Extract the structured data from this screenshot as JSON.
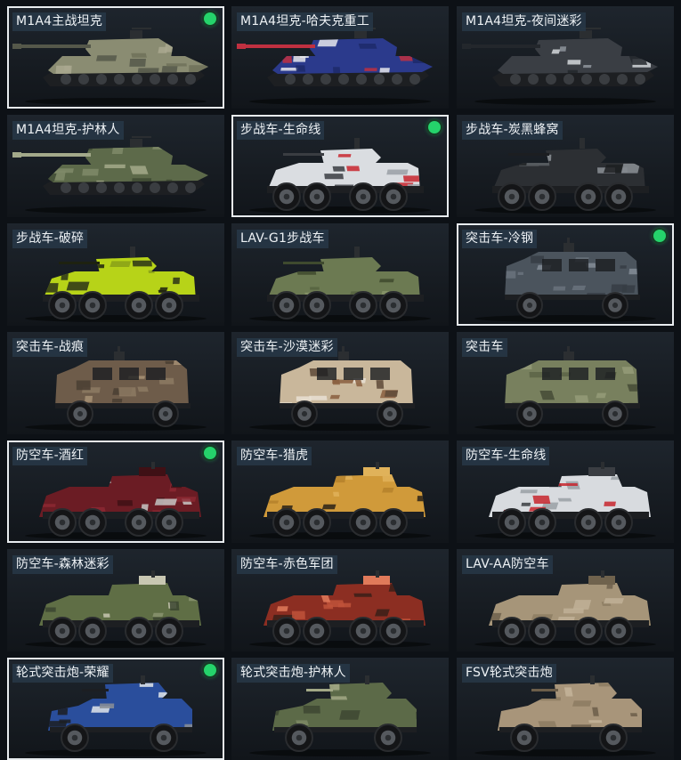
{
  "grid": {
    "columns": 3,
    "items": [
      {
        "label": "M1A4主战坦克",
        "kind": "tank",
        "camo": [
          "#8a8c72",
          "#6e7159",
          "#a9a88f",
          "#55584a"
        ],
        "selected": true,
        "equipped": true
      },
      {
        "label": "M1A4坦克-哈夫克重工",
        "kind": "tank",
        "camo": [
          "#2b3a8c",
          "#e6e8ec",
          "#1d2a6a",
          "#c03040"
        ],
        "selected": false,
        "equipped": false
      },
      {
        "label": "M1A4坦克-夜间迷彩",
        "kind": "tank",
        "camo": [
          "#3a3e44",
          "#8e949b",
          "#d5d8dc",
          "#23272c"
        ],
        "selected": false,
        "equipped": false
      },
      {
        "label": "M1A4坦克-护林人",
        "kind": "tank",
        "camo": [
          "#5d6a4a",
          "#7f8a68",
          "#3e4a33",
          "#a3a98a"
        ],
        "selected": false,
        "equipped": false
      },
      {
        "label": "步战车-生命线",
        "kind": "ifv",
        "camo": [
          "#dadde1",
          "#c8262e",
          "#9aa0a6",
          "#3a3d42"
        ],
        "selected": true,
        "equipped": true
      },
      {
        "label": "步战车-炭黑蜂窝",
        "kind": "ifv",
        "camo": [
          "#2c2f33",
          "#8c9096",
          "#5d6166",
          "#1c1e21"
        ],
        "selected": false,
        "equipped": false
      },
      {
        "label": "步战车-破碎",
        "kind": "ifv",
        "camo": [
          "#b7d318",
          "#2c3318",
          "#8aa018",
          "#1e2210"
        ],
        "selected": false,
        "equipped": false
      },
      {
        "label": "LAV-G1步战车",
        "kind": "ifv",
        "camo": [
          "#6c7a52",
          "#56633f",
          "#88956a",
          "#3f4a2e"
        ],
        "selected": false,
        "equipped": false
      },
      {
        "label": "突击车-冷钢",
        "kind": "mrap",
        "camo": [
          "#4b545d",
          "#6a737c",
          "#363d44",
          "#848d96"
        ],
        "selected": true,
        "equipped": true
      },
      {
        "label": "突击车-战痕",
        "kind": "mrap",
        "camo": [
          "#6e5c4a",
          "#8d7a63",
          "#4a3e33",
          "#a89276"
        ],
        "selected": false,
        "equipped": false
      },
      {
        "label": "突击车-沙漠迷彩",
        "kind": "mrap",
        "camo": [
          "#c9b79b",
          "#8a5f3f",
          "#e9e1d3",
          "#5e4a38"
        ],
        "selected": false,
        "equipped": false
      },
      {
        "label": "突击车",
        "kind": "mrap",
        "camo": [
          "#78805e",
          "#5c6447",
          "#949b78",
          "#454b36"
        ],
        "selected": false,
        "equipped": false
      },
      {
        "label": "防空车-酒红",
        "kind": "aa",
        "camo": [
          "#6b1c24",
          "#8c2832",
          "#c8c6c4",
          "#3f1015"
        ],
        "selected": true,
        "equipped": true
      },
      {
        "label": "防空车-猎虎",
        "kind": "aa",
        "camo": [
          "#d09a3a",
          "#2a2218",
          "#b5812c",
          "#e0b25a"
        ],
        "selected": false,
        "equipped": false
      },
      {
        "label": "防空车-生命线",
        "kind": "aa",
        "camo": [
          "#d8dbdf",
          "#c8262e",
          "#9aa0a6",
          "#3a3d42"
        ],
        "selected": false,
        "equipped": false
      },
      {
        "label": "防空车-森林迷彩",
        "kind": "aa",
        "camo": [
          "#5f6e45",
          "#3b4530",
          "#8a9470",
          "#c8c7b2"
        ],
        "selected": false,
        "equipped": false
      },
      {
        "label": "防空车-赤色军团",
        "kind": "aa",
        "camo": [
          "#8c2e22",
          "#c0523a",
          "#3a1e18",
          "#e07a5a"
        ],
        "selected": false,
        "equipped": false
      },
      {
        "label": "LAV-AA防空车",
        "kind": "aa",
        "camo": [
          "#a69579",
          "#8c7c62",
          "#c0b096",
          "#6f624d"
        ],
        "selected": false,
        "equipped": false
      },
      {
        "label": "轮式突击炮-荣耀",
        "kind": "fsv",
        "camo": [
          "#2a4e9c",
          "#e2e6ea",
          "#8c9096",
          "#1c1e22"
        ],
        "selected": true,
        "equipped": true
      },
      {
        "label": "轮式突击炮-护林人",
        "kind": "fsv",
        "camo": [
          "#5c6a48",
          "#7e8a66",
          "#3d4733",
          "#a2a886"
        ],
        "selected": false,
        "equipped": false
      },
      {
        "label": "FSV轮式突击炮",
        "kind": "fsv",
        "camo": [
          "#a8957a",
          "#8c7b62",
          "#c4b49a",
          "#6c5e4a"
        ],
        "selected": false,
        "equipped": false
      }
    ]
  }
}
